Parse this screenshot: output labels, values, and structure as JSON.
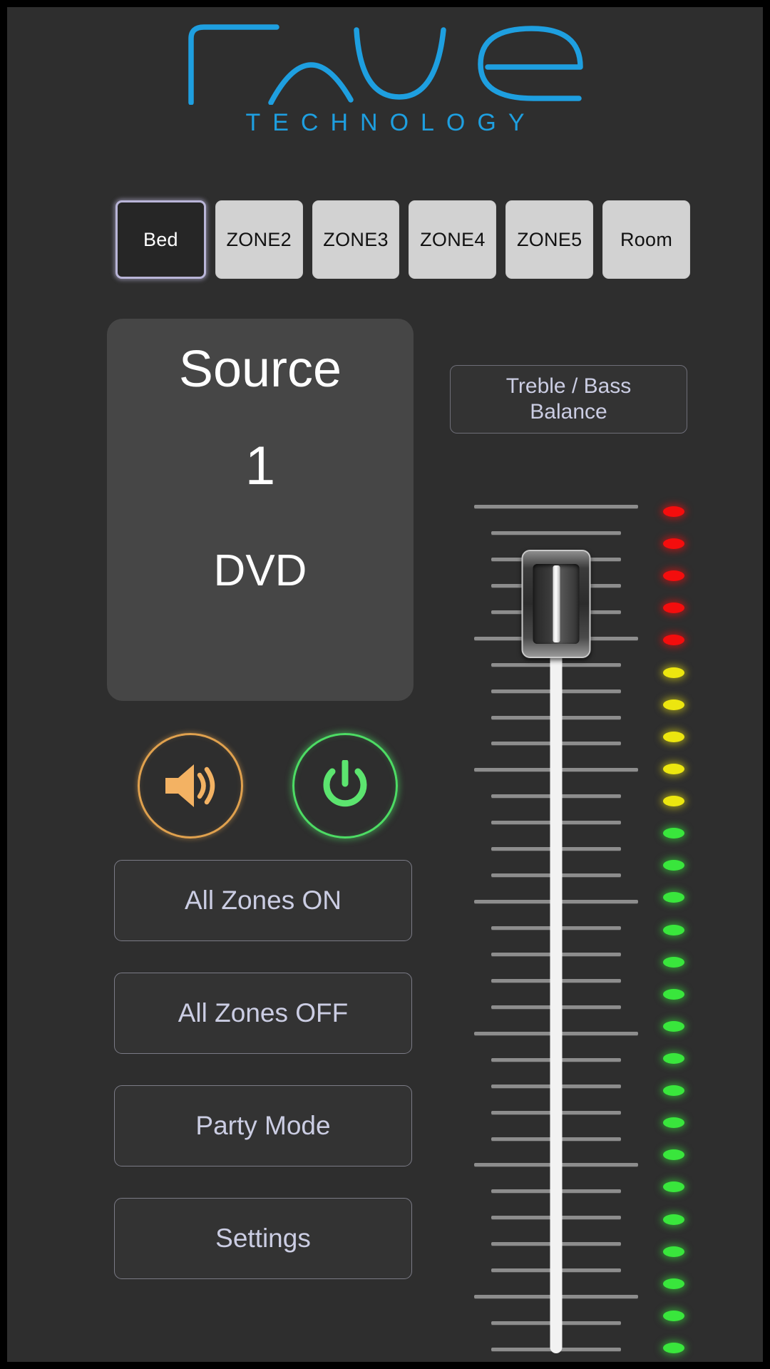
{
  "brand": {
    "logo_text": "rave",
    "wordmark": "TECHNOLOGY",
    "accent_color": "#1e9fe0"
  },
  "zones": {
    "selected_index": 0,
    "items": [
      {
        "label": "Bed",
        "selected": true
      },
      {
        "label": "ZONE2",
        "selected": false
      },
      {
        "label": "ZONE3",
        "selected": false
      },
      {
        "label": "ZONE4",
        "selected": false
      },
      {
        "label": "ZONE5",
        "selected": false
      },
      {
        "label": "Room",
        "selected": false
      }
    ]
  },
  "source": {
    "title": "Source",
    "number": "1",
    "name": "DVD"
  },
  "tone": {
    "label": "Treble / Bass\nBalance",
    "line1": "Treble / Bass",
    "line2": "Balance"
  },
  "icon_buttons": [
    {
      "name": "volume-icon",
      "color": "#e0a14e"
    },
    {
      "name": "power-icon",
      "color": "#4ddc64"
    }
  ],
  "actions": [
    {
      "label": "All Zones ON"
    },
    {
      "label": "All Zones OFF"
    },
    {
      "label": "Party Mode"
    },
    {
      "label": "Settings"
    }
  ],
  "fader": {
    "name": "volume-fader",
    "orientation": "vertical",
    "value_percent": 92,
    "major_tick_count": 7,
    "total_tick_count": 33
  },
  "led_meter": {
    "name": "level-meter",
    "total": 27,
    "red_count": 5,
    "yellow_count": 5,
    "green_count": 17,
    "colors": {
      "red": "#f40d0d",
      "yellow": "#ece60f",
      "green": "#39e63c"
    }
  }
}
